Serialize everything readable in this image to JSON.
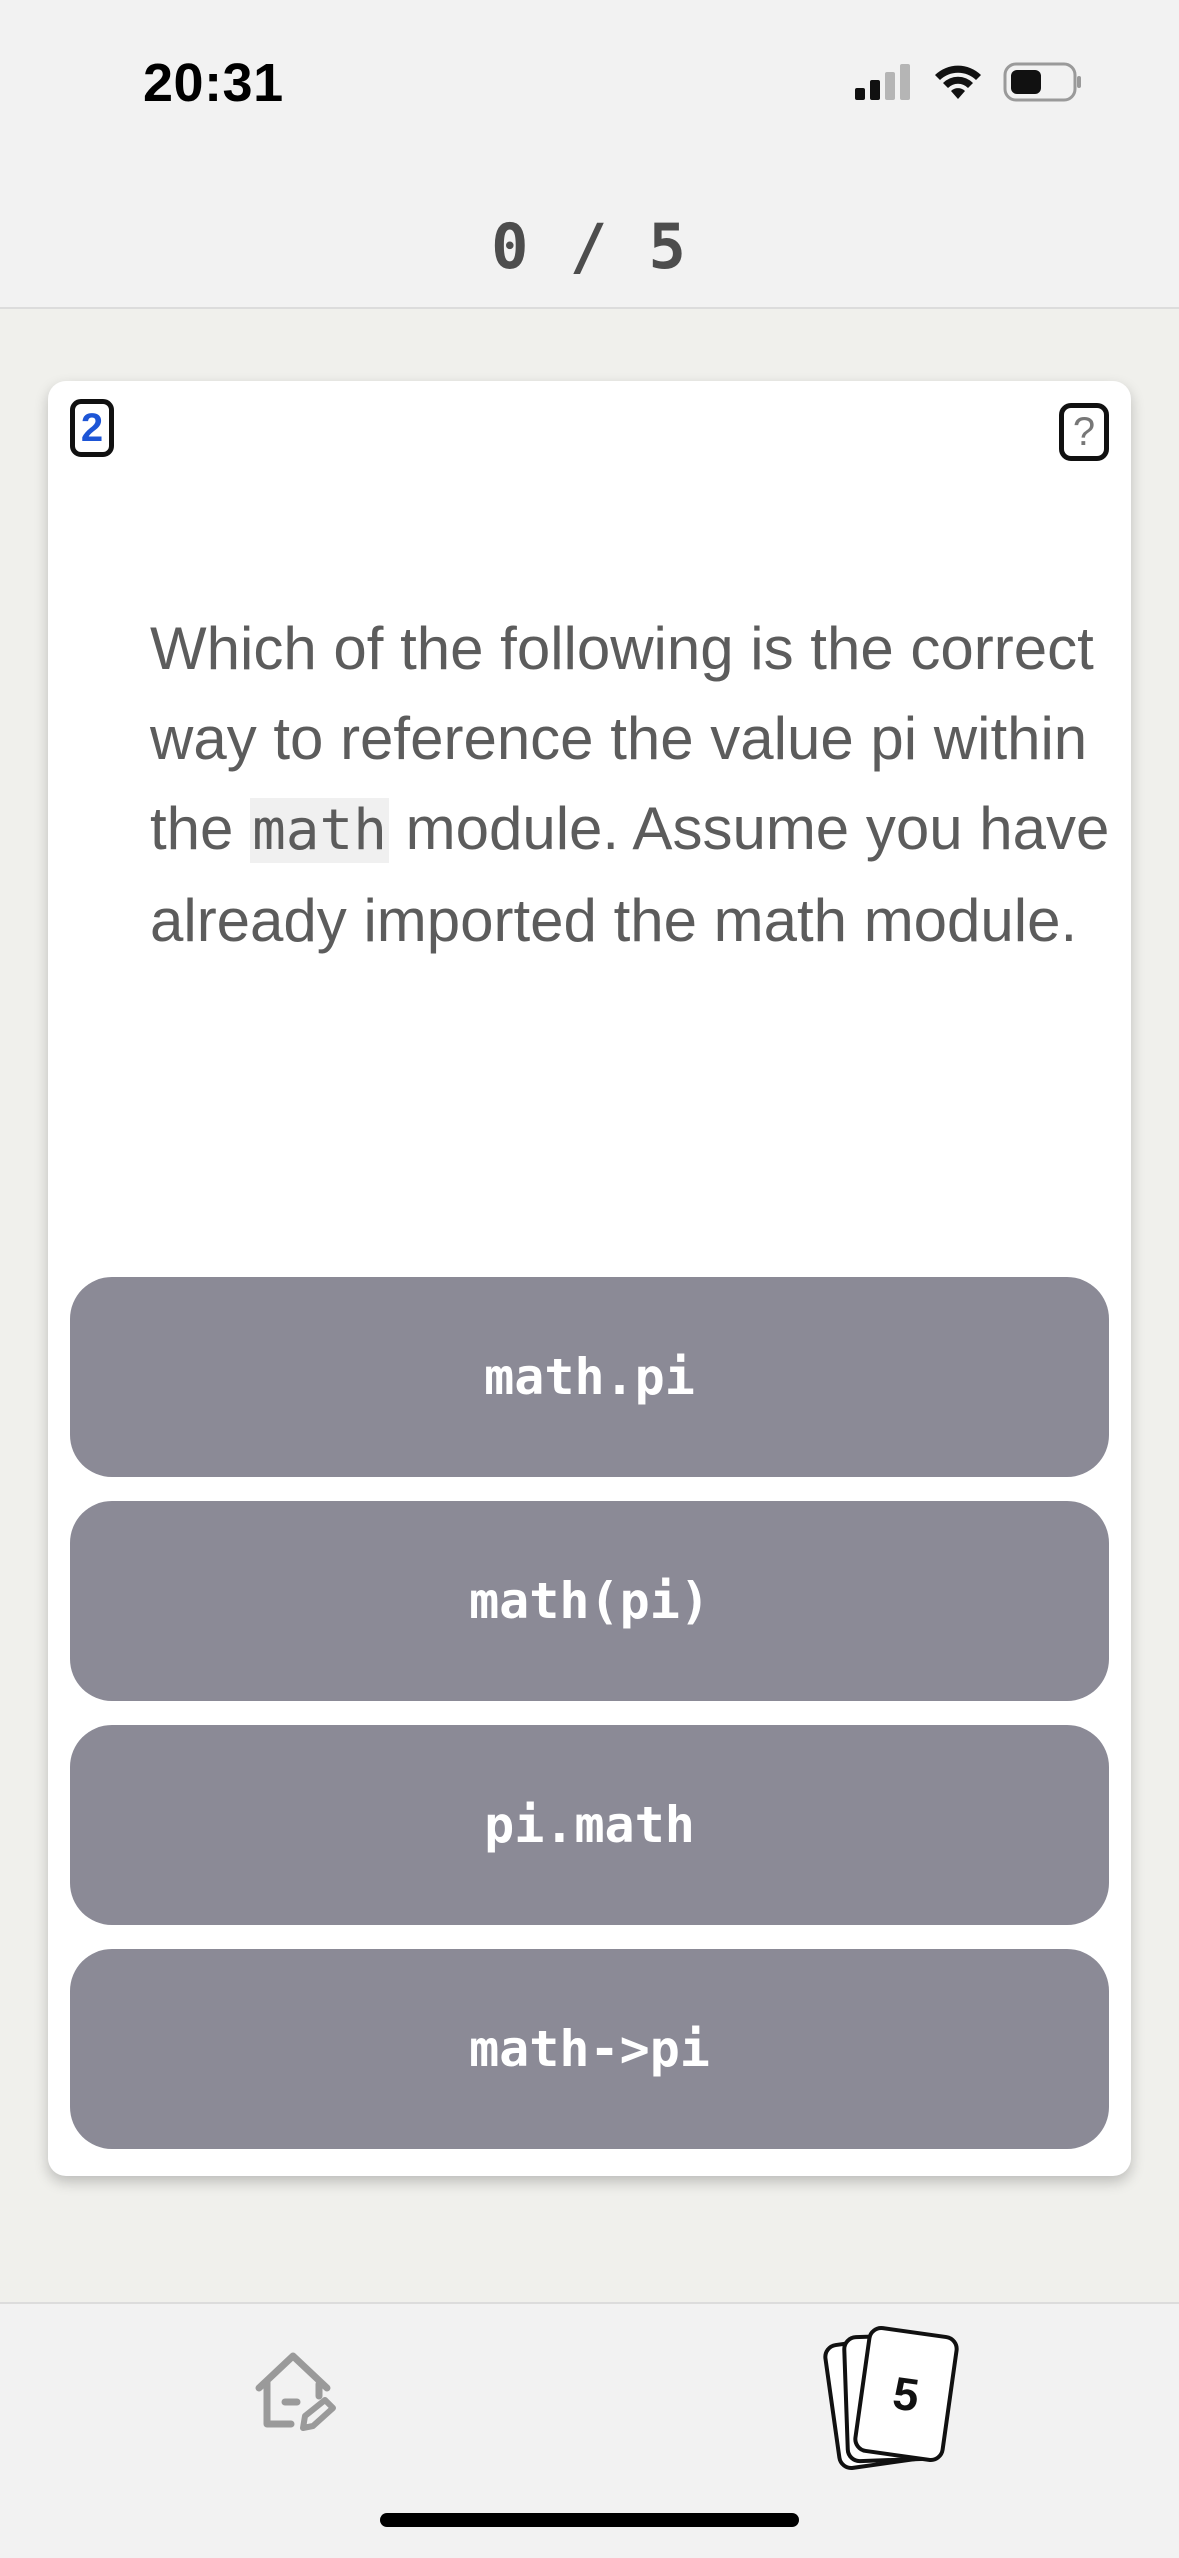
{
  "status_bar": {
    "time": "20:31",
    "icons": [
      "cellular-signal-icon",
      "wifi-icon",
      "battery-icon"
    ]
  },
  "header": {
    "progress": "0 / 5"
  },
  "card": {
    "badge_number": "2",
    "help_label": "?",
    "question_before": "Which of the following is the correct way to reference the value pi within the ",
    "question_code": "math",
    "question_after": " module. Assume you have already imported the math module.",
    "answers": [
      "math.pi",
      "math(pi)",
      "pi.math",
      "math->pi"
    ]
  },
  "bottom_nav": {
    "home_icon": "home-edit-icon",
    "deck_count": "5"
  },
  "colors": {
    "answer_bg": "#8b8a96",
    "badge_number": "#1d55d6",
    "background": "#f0f0ec"
  }
}
